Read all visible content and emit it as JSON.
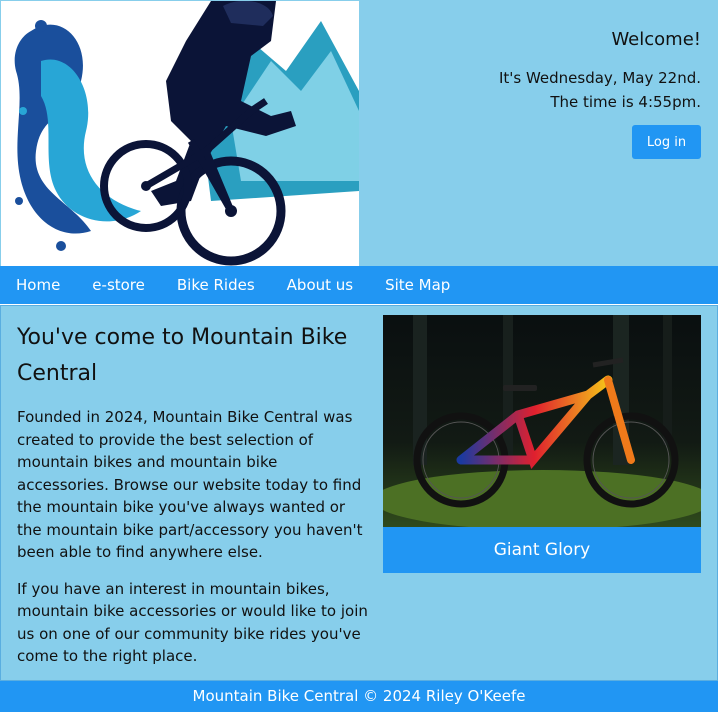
{
  "header": {
    "logo_icon": "mountain-biker-logo",
    "welcome": "Welcome!",
    "date_line": "It's Wednesday, May 22nd.",
    "time_line": "The time is 4:55pm.",
    "login_label": "Log in"
  },
  "nav": {
    "items": [
      "Home",
      "e-store",
      "Bike Rides",
      "About us",
      "Site Map"
    ]
  },
  "main": {
    "heading": "You've come to Mountain Bike Central",
    "paragraph1": "Founded in 2024, Mountain Bike Central was created to provide the best selection of mountain bikes and mountain bike accessories. Browse our website today to find the mountain bike you've always wanted or the mountain bike part/accessory you haven't been able to find anywhere else.",
    "paragraph2": "If you have an interest in mountain bikes, mountain bike accessories or would like to join us on one of our community bike rides you've come to the right place.",
    "photo_icon": "mountain-bike-photo",
    "caption": "Giant Glory"
  },
  "footer": {
    "text": "Mountain Bike Central © 2024 Riley O'Keefe"
  },
  "colors": {
    "header_bg": "#87ceeb",
    "accent": "#2196f3"
  }
}
